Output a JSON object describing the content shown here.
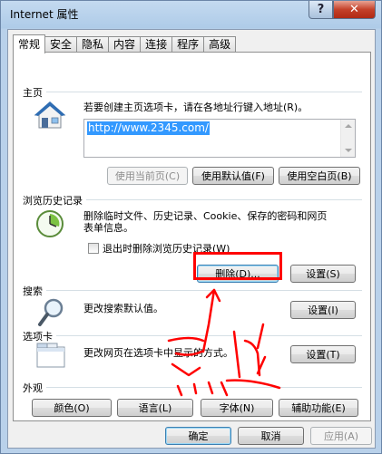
{
  "window": {
    "title": "Internet 属性",
    "help_glyph": "?",
    "close_glyph": "✕"
  },
  "tabs": [
    {
      "label": "常规",
      "active": true
    },
    {
      "label": "安全"
    },
    {
      "label": "隐私"
    },
    {
      "label": "内容"
    },
    {
      "label": "连接"
    },
    {
      "label": "程序"
    },
    {
      "label": "高级"
    }
  ],
  "homepage": {
    "group_title": "主页",
    "description": "若要创建主页选项卡，请在各地址行键入地址(R)。",
    "url": "http://www.2345.com/",
    "btn_use_current": "使用当前页(C)",
    "btn_use_default": "使用默认值(F)",
    "btn_use_blank": "使用空白页(B)"
  },
  "history": {
    "group_title": "浏览历史记录",
    "description_line1": "删除临时文件、历史记录、Cookie、保存的密码和网页",
    "description_line2": "表单信息。",
    "checkbox_label": "退出时删除浏览历史记录(W)",
    "btn_delete": "删除(D)...",
    "btn_settings": "设置(S)"
  },
  "search": {
    "group_title": "搜索",
    "description": "更改搜索默认值。",
    "btn_settings": "设置(I)"
  },
  "tabs_section": {
    "group_title": "选项卡",
    "description": "更改网页在选项卡中显示的方式。",
    "btn_settings": "设置(T)"
  },
  "appearance": {
    "group_title": "外观",
    "btn_colors": "颜色(O)",
    "btn_languages": "语言(L)",
    "btn_fonts": "字体(N)",
    "btn_accessibility": "辅助功能(E)"
  },
  "footer": {
    "btn_ok": "确定",
    "btn_cancel": "取消",
    "btn_apply": "应用(A)"
  },
  "colors": {
    "annotation_red": "#ff0000",
    "selection_blue": "#3399ff"
  }
}
